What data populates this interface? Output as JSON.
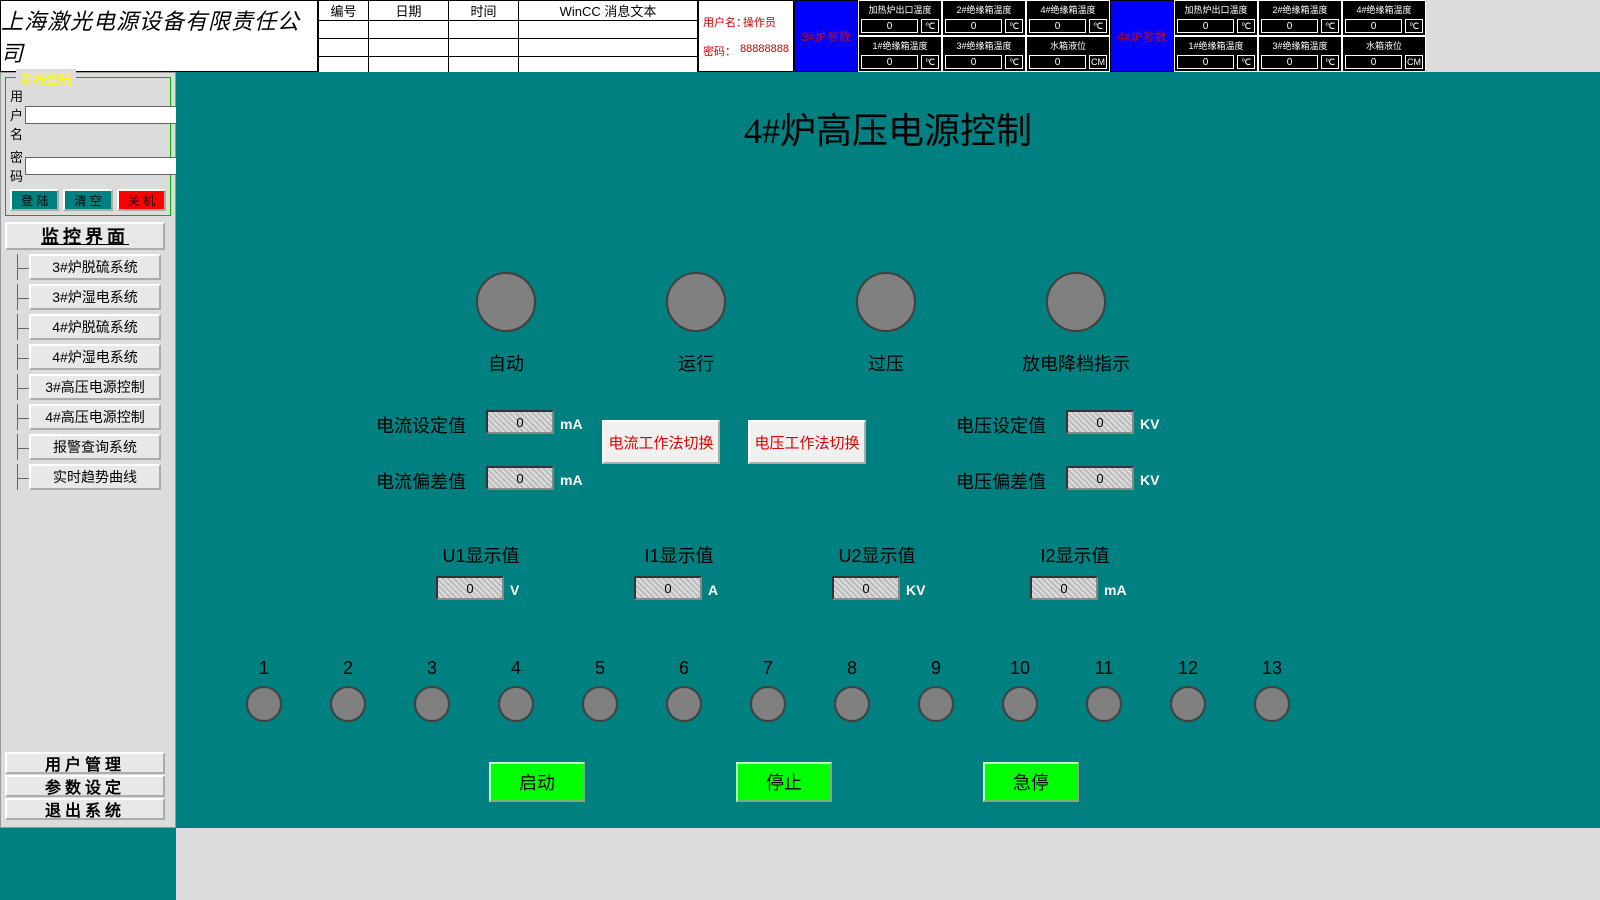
{
  "company": "上海激光电源设备有限责任公司",
  "alarm_table": {
    "h1": "编号",
    "h2": "日期",
    "h3": "时间",
    "h4": "WinCC 消息文本"
  },
  "userbox": {
    "userLabel": "用户名：",
    "userVal": "操作员",
    "passLabel": "密码：",
    "passVal": "88888888"
  },
  "paramBlocks": [
    {
      "title": "3#炉参数",
      "cells": [
        {
          "label": "加热炉出口温度",
          "val": "0",
          "unit": "℃"
        },
        {
          "label": "2#绝缘箱温度",
          "val": "0",
          "unit": "℃"
        },
        {
          "label": "4#绝缘箱温度",
          "val": "0",
          "unit": "℃"
        },
        {
          "label": "1#绝缘箱温度",
          "val": "0",
          "unit": "℃"
        },
        {
          "label": "3#绝缘箱温度",
          "val": "0",
          "unit": "℃"
        },
        {
          "label": "水箱液位",
          "val": "0",
          "unit": "CM"
        }
      ]
    },
    {
      "title": "4#炉参数",
      "cells": [
        {
          "label": "加热炉出口温度",
          "val": "0",
          "unit": "℃"
        },
        {
          "label": "2#绝缘箱温度",
          "val": "0",
          "unit": "℃"
        },
        {
          "label": "4#绝缘箱温度",
          "val": "0",
          "unit": "℃"
        },
        {
          "label": "1#绝缘箱温度",
          "val": "0",
          "unit": "℃"
        },
        {
          "label": "3#绝缘箱温度",
          "val": "0",
          "unit": "℃"
        },
        {
          "label": "水箱液位",
          "val": "0",
          "unit": "CM"
        }
      ]
    }
  ],
  "login": {
    "legend": "系统登陆",
    "userLabel": "用户名",
    "passLabel": "密 码",
    "userVal": "",
    "passVal": "",
    "btnLogin": "登 陆",
    "btnClear": "清 空",
    "btnShut": "关 机"
  },
  "navRoot": "监控界面",
  "navItems": [
    "3#炉脱硫系统",
    "3#炉湿电系统",
    "4#炉脱硫系统",
    "4#炉湿电系统",
    "3#高压电源控制",
    "4#高压电源控制",
    "报警查询系统",
    "实时趋势曲线"
  ],
  "navBottom": [
    "用户管理",
    "参数设定",
    "退出系统"
  ],
  "main": {
    "title": "4#炉高压电源控制",
    "lamps": [
      "自动",
      "运行",
      "过压",
      "放电降档指示"
    ],
    "fields": {
      "curSet": {
        "label": "电流设定值",
        "val": "0",
        "unit": "mA"
      },
      "curDev": {
        "label": "电流偏差值",
        "val": "0",
        "unit": "mA"
      },
      "voltSet": {
        "label": "电压设定值",
        "val": "0",
        "unit": "KV"
      },
      "voltDev": {
        "label": "电压偏差值",
        "val": "0",
        "unit": "KV"
      }
    },
    "modeBtns": [
      "电流工作法切换",
      "电压工作法切换"
    ],
    "disp": [
      {
        "label": "U1显示值",
        "val": "0",
        "unit": "V"
      },
      {
        "label": "I1显示值",
        "val": "0",
        "unit": "A"
      },
      {
        "label": "U2显示值",
        "val": "0",
        "unit": "KV"
      },
      {
        "label": "I2显示值",
        "val": "0",
        "unit": "mA"
      }
    ],
    "indices": [
      "1",
      "2",
      "3",
      "4",
      "5",
      "6",
      "7",
      "8",
      "9",
      "10",
      "11",
      "12",
      "13"
    ],
    "actions": [
      "启动",
      "停止",
      "急停"
    ]
  }
}
